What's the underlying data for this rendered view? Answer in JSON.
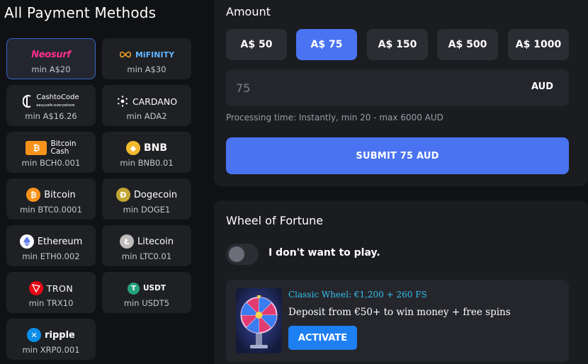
{
  "left": {
    "title": "All Payment Methods",
    "methods": [
      {
        "name": "Neosurf",
        "min": "min A$20",
        "selected": true
      },
      {
        "name": "MiFINITY",
        "min": "min A$30"
      },
      {
        "name": "CashtoCode",
        "sub": "easy.safe.everywhere",
        "min": "min A$16.26"
      },
      {
        "name": "CARDANO",
        "min": "min ADA2"
      },
      {
        "name": "Bitcoin",
        "name2": "Cash",
        "min": "min BCH0.001"
      },
      {
        "name": "BNB",
        "min": "min BNB0.01"
      },
      {
        "name": "Bitcoin",
        "min": "min BTC0.0001"
      },
      {
        "name": "Dogecoin",
        "min": "min DOGE1"
      },
      {
        "name": "Ethereum",
        "min": "min ETH0.002"
      },
      {
        "name": "Litecoin",
        "min": "min LTC0.01"
      },
      {
        "name": "TRON",
        "min": "min TRX10"
      },
      {
        "name": "USDT",
        "min": "min USDT5"
      },
      {
        "name": "ripple",
        "min": "min XRP0.001"
      }
    ]
  },
  "amount": {
    "title": "Amount",
    "presets": [
      "A$ 50",
      "A$ 75",
      "A$ 150",
      "A$ 500",
      "A$ 1000"
    ],
    "active_preset": "A$ 75",
    "input_value": "75",
    "currency": "AUD",
    "processing_text": "Processing time: Instantly, min 20 - max 6000 AUD",
    "submit_label": "SUBMIT 75 AUD"
  },
  "wheel": {
    "title": "Wheel of Fortune",
    "toggle_label": "I don't want to play.",
    "offer_title": "Classic Wheel: €1,200 + 260 FS",
    "offer_desc": "Deposit from €50+ to win money + free spins",
    "activate_label": "ACTIVATE"
  },
  "colors": {
    "accent": "#4a73f2",
    "activate": "#1e7ff2",
    "offer_title": "#33c2f0",
    "neosurf": "#ff2f8e"
  }
}
